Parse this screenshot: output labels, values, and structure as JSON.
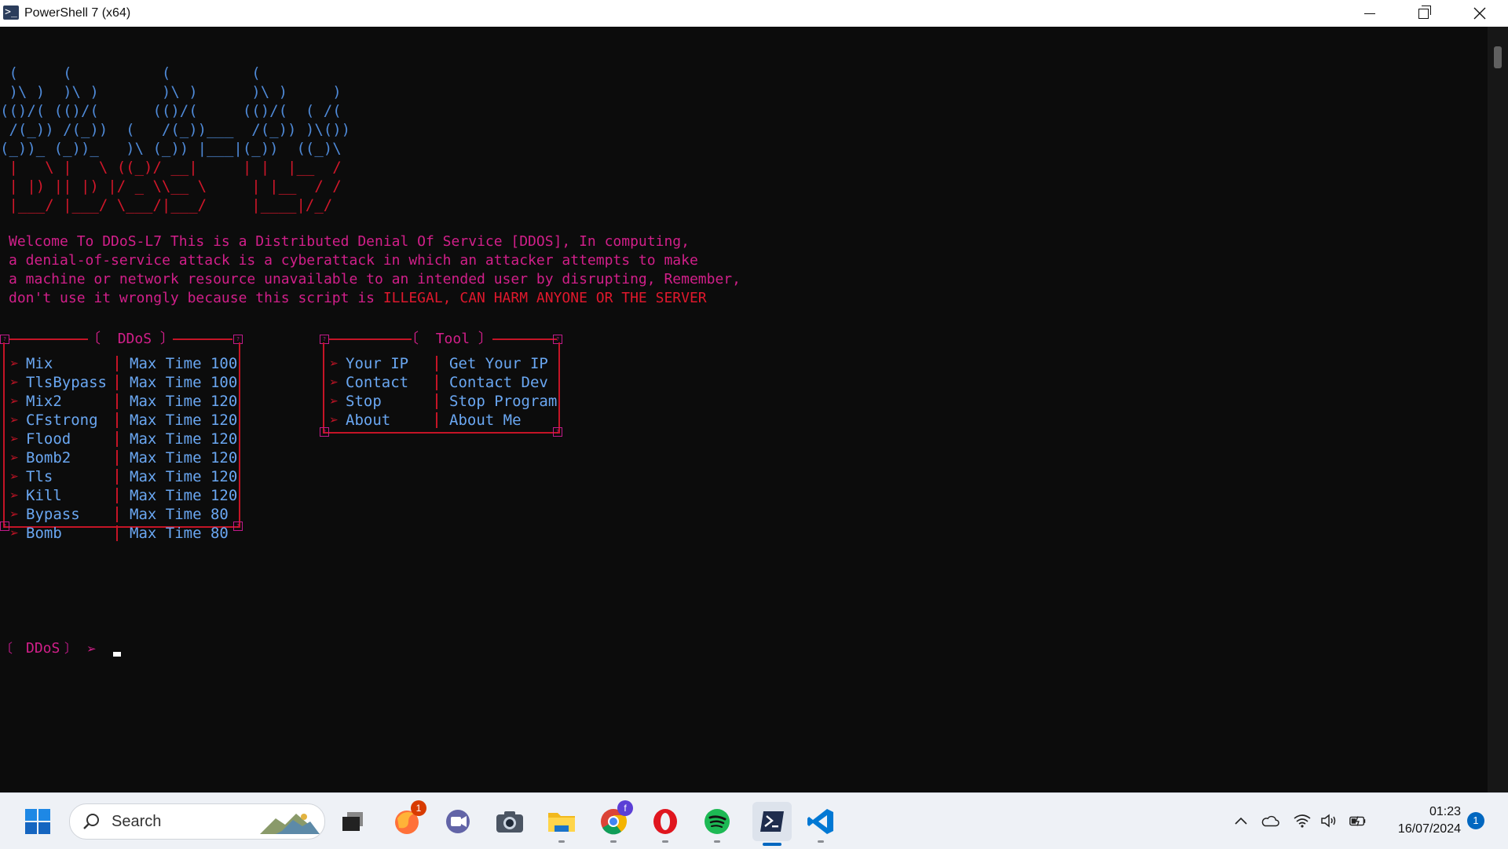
{
  "window": {
    "title": "PowerShell 7 (x64)",
    "app_icon": "powershell-icon"
  },
  "banner": {
    "blue_art": " (     (          (         (\n )\\ )  )\\ )       )\\ )      )\\ )     )\n(()/( (()/(      (()/(     (()/(  ( /(\n /(_)) /(_))  (   /(_))___  /(_)) )\\())\n(_))_ (_))_   )\\ (_)) |___|(_))  ((_)\\",
    "red_art": " |   \\ |   \\ ((_)/ __|     | |  |__  /\n | |) || |) |/ _ \\\\__ \\     | |__  / /\n |___/ |___/ \\___/|___/     |____|/_/"
  },
  "welcome": {
    "lines": [
      "Welcome To DDoS-L7 This is a Distributed Denial Of Service [DDOS], In computing,",
      "a denial-of-service attack is a cyberattack in which an attacker attempts to make",
      "a machine or network resource unavailable to an intended user by disrupting, Remember,"
    ],
    "warning_prefix": "don't use it wrongly because this script is ",
    "warning_text": "ILLEGAL, CAN HARM ANYONE OR THE SERVER"
  },
  "ddos_menu": {
    "title": "DDoS",
    "items": [
      {
        "name": "Mix",
        "value": "Max Time 100"
      },
      {
        "name": "TlsBypass",
        "value": "Max Time 100"
      },
      {
        "name": "Mix2",
        "value": "Max Time 120"
      },
      {
        "name": "CFstrong",
        "value": "Max Time 120"
      },
      {
        "name": "Flood",
        "value": "Max Time 120"
      },
      {
        "name": "Bomb2",
        "value": "Max Time 120"
      },
      {
        "name": "Tls",
        "value": "Max Time 120"
      },
      {
        "name": "Kill",
        "value": "Max Time 120"
      },
      {
        "name": "Bypass",
        "value": "Max Time 80"
      },
      {
        "name": "Bomb",
        "value": "Max Time 80"
      }
    ]
  },
  "tool_menu": {
    "title": "Tool",
    "items": [
      {
        "name": "Your IP",
        "value": "Get Your IP"
      },
      {
        "name": "Contact",
        "value": "Contact Dev"
      },
      {
        "name": "Stop",
        "value": "Stop Program"
      },
      {
        "name": "About",
        "value": "About Me"
      }
    ]
  },
  "prompt": {
    "label": "DDoS",
    "arrow": "➢"
  },
  "taskbar": {
    "search_placeholder": "Search",
    "apps": [
      {
        "name": "task-view-icon"
      },
      {
        "name": "firefox-icon",
        "badge": "1"
      },
      {
        "name": "teams-icon"
      },
      {
        "name": "camera-icon"
      },
      {
        "name": "file-explorer-icon"
      },
      {
        "name": "chrome-icon",
        "badge": "f"
      },
      {
        "name": "opera-icon"
      },
      {
        "name": "spotify-icon"
      },
      {
        "name": "terminal-icon"
      },
      {
        "name": "vscode-icon"
      }
    ],
    "time": "01:23",
    "date": "16/07/2024",
    "notification_count": "1"
  },
  "colors": {
    "terminal_bg": "#0c0c0c",
    "ascii_blue": "#4f8ad8",
    "ascii_red": "#d1172a",
    "magenta": "#d21f8a",
    "menu_text": "#6aa7f2",
    "frame_red": "#c41426",
    "accent": "#0067c0"
  }
}
